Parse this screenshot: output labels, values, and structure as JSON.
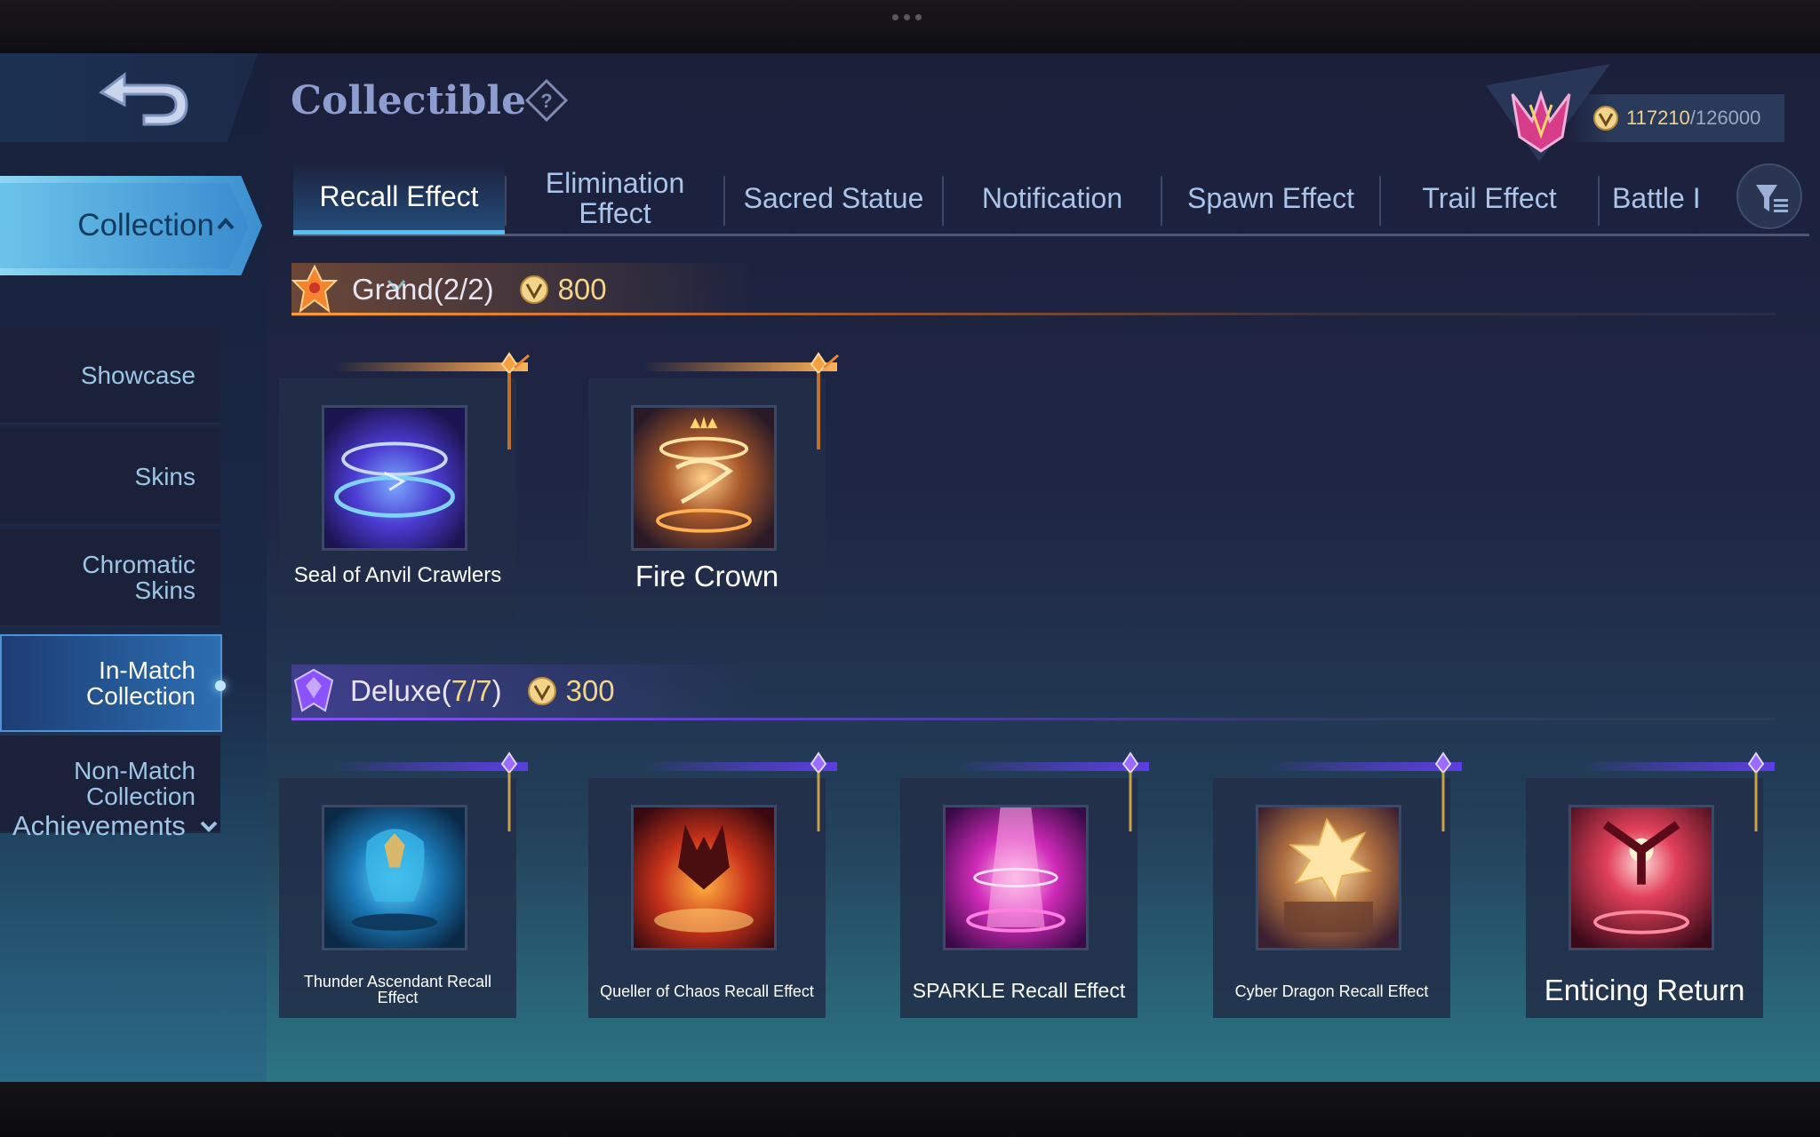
{
  "page": {
    "title": "Collectible",
    "points": {
      "current": "117210",
      "max": "/126000"
    }
  },
  "sidebar": {
    "collection_label": "Collection",
    "items": [
      {
        "label": "Showcase"
      },
      {
        "label": "Skins"
      },
      {
        "label": "Chromatic Skins"
      },
      {
        "label": "In-Match Collection",
        "active": true
      },
      {
        "label": "Non-Match Collection"
      }
    ],
    "achievements_label": "Achievements"
  },
  "tabs": [
    {
      "label": "Recall Effect",
      "active": true
    },
    {
      "label": "Elimination Effect"
    },
    {
      "label": "Sacred Statue"
    },
    {
      "label": "Notification"
    },
    {
      "label": "Spawn Effect"
    },
    {
      "label": "Trail Effect"
    },
    {
      "label": "Battle I"
    }
  ],
  "sections": {
    "grand": {
      "title": "Grand(2/2)",
      "price": "800",
      "items": [
        {
          "name": "Seal of Anvil Crawlers",
          "icon": "seal-of-anvil-crawlers-thumb"
        },
        {
          "name": "Fire Crown",
          "icon": "fire-crown-thumb"
        }
      ]
    },
    "deluxe": {
      "title_prefix": "Deluxe(",
      "title_count": "7/7",
      "title_suffix": ")",
      "price": "300",
      "items": [
        {
          "name": "Thunder Ascendant Recall Effect",
          "icon": "thunder-ascendant-thumb"
        },
        {
          "name": "Queller of Chaos Recall Effect",
          "icon": "queller-of-chaos-thumb"
        },
        {
          "name": "SPARKLE Recall Effect",
          "icon": "sparkle-thumb"
        },
        {
          "name": "Cyber Dragon Recall Effect",
          "icon": "cyber-dragon-thumb"
        },
        {
          "name": "Enticing Return",
          "icon": "enticing-return-thumb"
        }
      ]
    }
  },
  "colors": {
    "accent_cyan": "#52c4ef",
    "grand_orange": "#ff9a3c",
    "deluxe_purple": "#8b52ff",
    "price_gold": "#f2d48c"
  }
}
